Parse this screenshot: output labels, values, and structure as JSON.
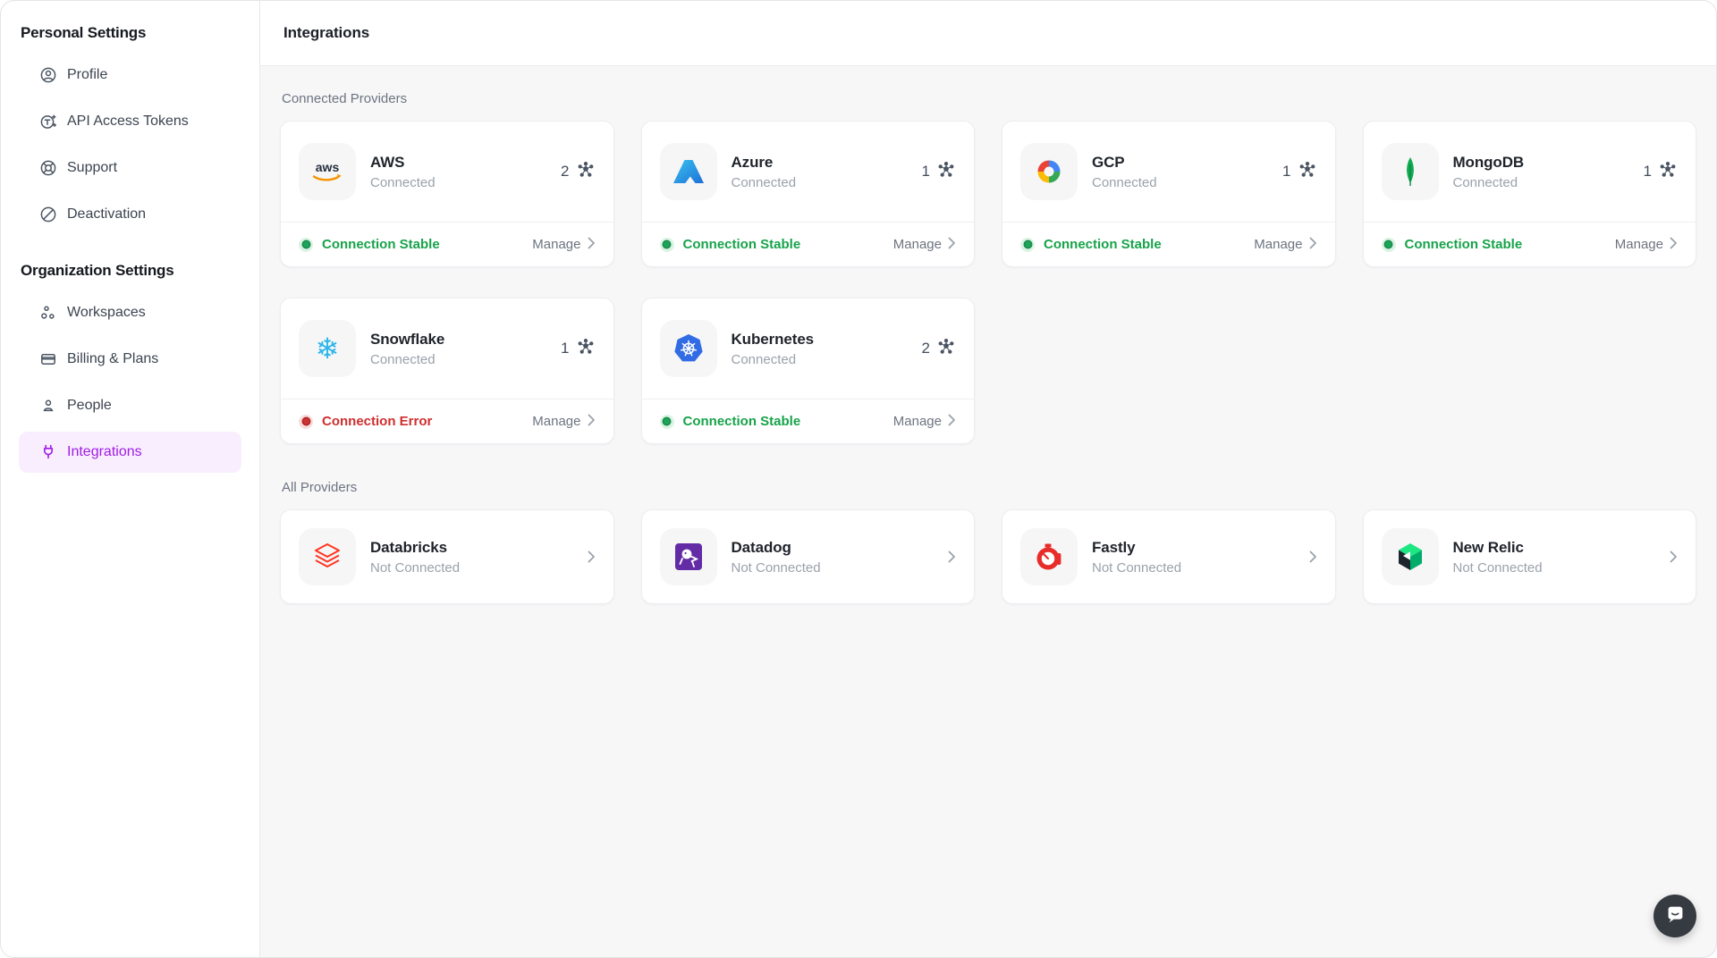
{
  "sidebar": {
    "sections": [
      {
        "title": "Personal Settings",
        "items": [
          {
            "label": "Profile",
            "icon": "user-circle"
          },
          {
            "label": "API Access Tokens",
            "icon": "token"
          },
          {
            "label": "Support",
            "icon": "lifebuoy"
          },
          {
            "label": "Deactivation",
            "icon": "ban"
          }
        ]
      },
      {
        "title": "Organization Settings",
        "items": [
          {
            "label": "Workspaces",
            "icon": "workspaces"
          },
          {
            "label": "Billing & Plans",
            "icon": "credit-card"
          },
          {
            "label": "People",
            "icon": "person"
          },
          {
            "label": "Integrations",
            "icon": "plug",
            "active": true
          }
        ]
      }
    ]
  },
  "header": {
    "title": "Integrations"
  },
  "content": {
    "connected_label": "Connected Providers",
    "all_label": "All Providers",
    "manage_label": "Manage",
    "connected_providers": [
      {
        "name": "AWS",
        "status": "Connected",
        "count": "2",
        "connection": "Connection Stable",
        "connection_state": "stable",
        "logo": "aws"
      },
      {
        "name": "Azure",
        "status": "Connected",
        "count": "1",
        "connection": "Connection Stable",
        "connection_state": "stable",
        "logo": "azure"
      },
      {
        "name": "GCP",
        "status": "Connected",
        "count": "1",
        "connection": "Connection Stable",
        "connection_state": "stable",
        "logo": "gcp"
      },
      {
        "name": "MongoDB",
        "status": "Connected",
        "count": "1",
        "connection": "Connection Stable",
        "connection_state": "stable",
        "logo": "mongodb"
      },
      {
        "name": "Snowflake",
        "status": "Connected",
        "count": "1",
        "connection": "Connection Error",
        "connection_state": "error",
        "logo": "snowflake"
      },
      {
        "name": "Kubernetes",
        "status": "Connected",
        "count": "2",
        "connection": "Connection Stable",
        "connection_state": "stable",
        "logo": "kubernetes"
      }
    ],
    "all_providers": [
      {
        "name": "Databricks",
        "status": "Not Connected",
        "logo": "databricks"
      },
      {
        "name": "Datadog",
        "status": "Not Connected",
        "logo": "datadog"
      },
      {
        "name": "Fastly",
        "status": "Not Connected",
        "logo": "fastly"
      },
      {
        "name": "New Relic",
        "status": "Not Connected",
        "logo": "newrelic"
      }
    ]
  },
  "colors": {
    "accent_purple": "#a21be6",
    "accent_purple_bg": "#f8eefe",
    "status_ok": "#17a34a",
    "status_error": "#cf2e2e",
    "body_bg": "#f7f7f8"
  }
}
